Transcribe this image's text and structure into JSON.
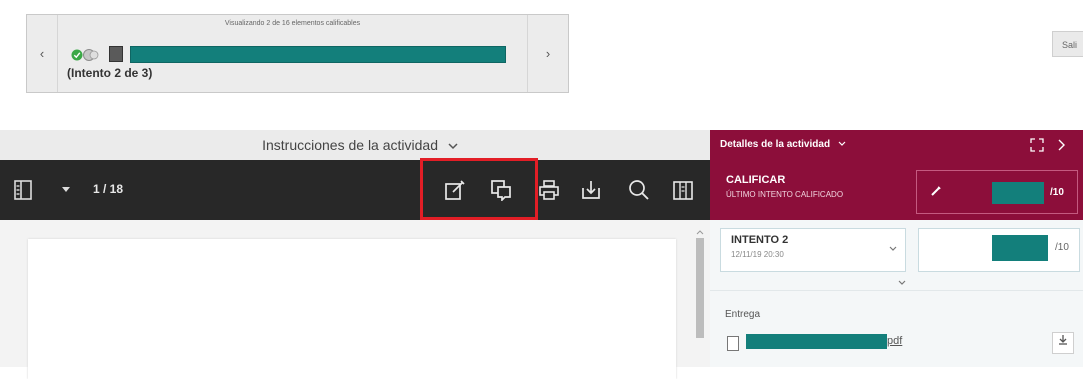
{
  "navigator": {
    "prev_icon": "chevron-left-icon",
    "next_icon": "chevron-right-icon",
    "count_text": "Visualizando 2 de 16 elementos calificables",
    "attempt_text": "(Intento 2 de 3)"
  },
  "exit_button": "Sali",
  "document": {
    "header_title": "Instrucciones de la actividad",
    "page_count": "1 / 18"
  },
  "grading": {
    "header_title": "Detalles de la actividad",
    "grade_title": "CALIFICAR",
    "grade_subtitle": "ÚLTIMO INTENTO CALIFICADO",
    "grade_max": "/10",
    "attempt_title": "INTENTO 2",
    "attempt_date": "12/11/19 20:30",
    "attempt_max": "/10",
    "entrega_label": "Entrega",
    "file_ext": "pdf"
  },
  "colors": {
    "accent": "#8c0e3a",
    "teal": "#137f7b",
    "toolbar": "#282828",
    "highlight": "#e21e26"
  }
}
